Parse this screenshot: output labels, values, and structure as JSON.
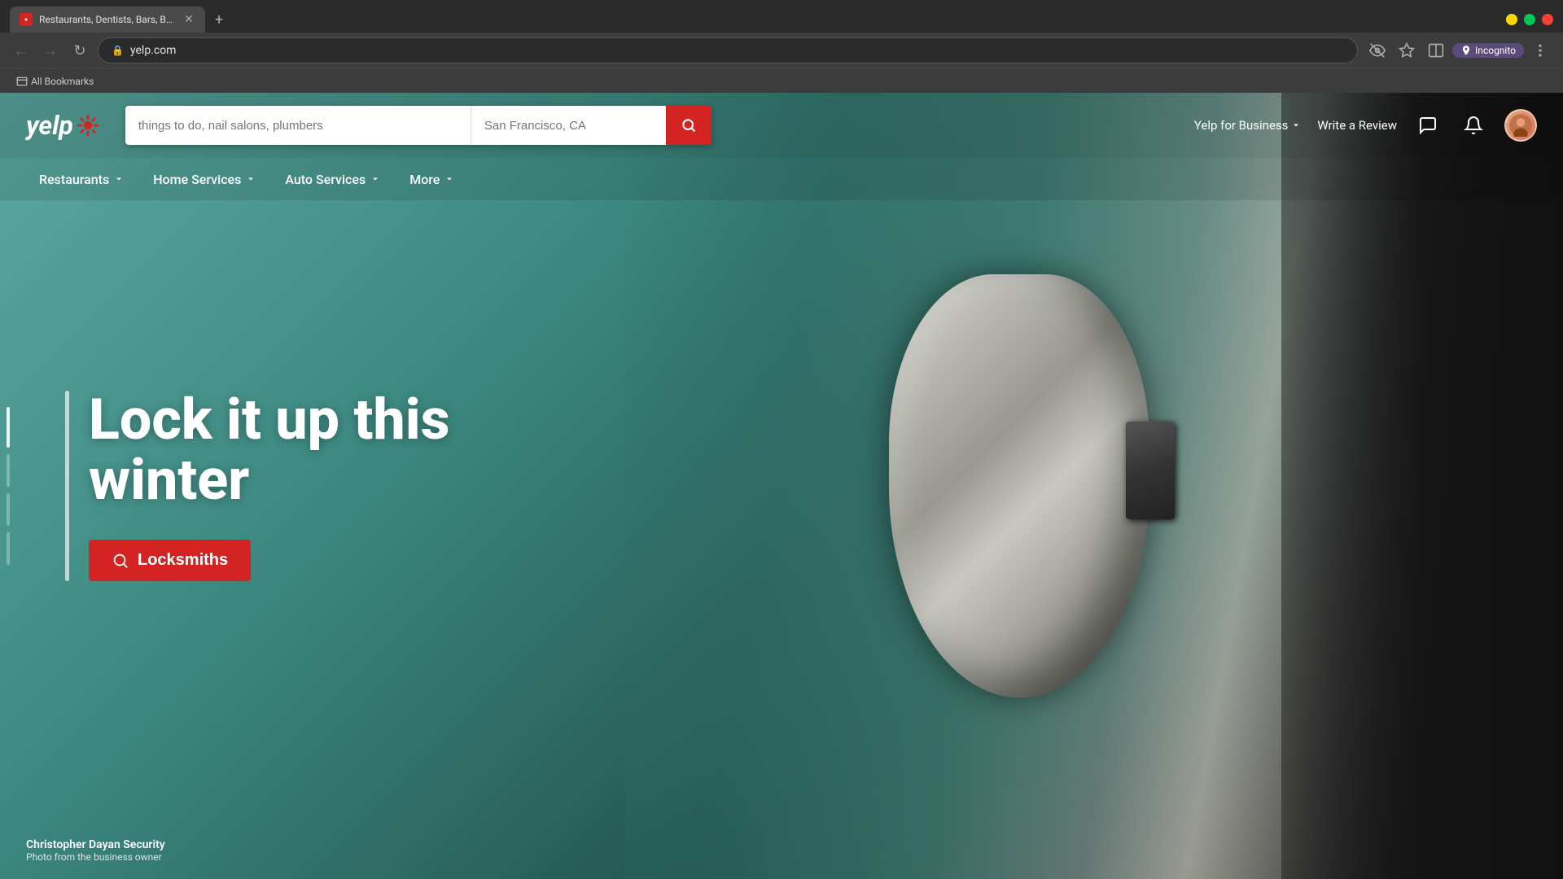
{
  "browser": {
    "tab": {
      "title": "Restaurants, Dentists, Bars, Bea...",
      "favicon": "y",
      "url": "yelp.com"
    },
    "new_tab_label": "+",
    "bookmarks": {
      "label": "All Bookmarks"
    },
    "incognito": "Incognito",
    "window_controls": {
      "minimize": "—",
      "maximize": "□",
      "close": "✕"
    }
  },
  "search": {
    "what_placeholder": "things to do, nail salons, plumbers",
    "where_placeholder": "San Francisco, CA",
    "button_aria": "Search"
  },
  "header": {
    "logo_text": "yelp",
    "yelp_for_business": "Yelp for Business",
    "write_review": "Write a Review"
  },
  "nav": {
    "items": [
      {
        "label": "Restaurants",
        "has_dropdown": true
      },
      {
        "label": "Home Services",
        "has_dropdown": true
      },
      {
        "label": "Auto Services",
        "has_dropdown": true
      },
      {
        "label": "More",
        "has_dropdown": true
      }
    ]
  },
  "hero": {
    "title_line1": "Lock it up this",
    "title_line2": "winter",
    "cta_label": "Locksmiths"
  },
  "photo_credit": {
    "name": "Christopher Dayan Security",
    "description": "Photo from the business owner"
  },
  "colors": {
    "yelp_red": "#d32323",
    "hero_teal": "#5ba8a0"
  }
}
